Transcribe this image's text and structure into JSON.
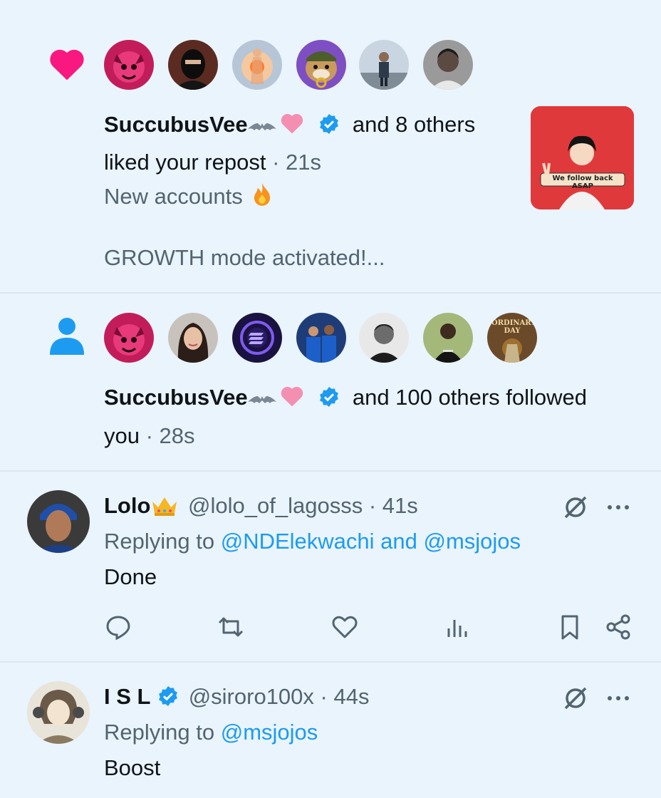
{
  "notifications": [
    {
      "type": "like",
      "actor": "SuccubusVee",
      "actor_emojis": [
        "bat-emoji",
        "pink-heart-emoji"
      ],
      "others_text": "and 8 others",
      "action_text": "liked your repost",
      "time": "· 21s",
      "preview_line1": "New accounts",
      "preview_line2": "GROWTH mode activated!...",
      "thumbnail_caption": "We follow back ASAP",
      "avatars": [
        "pink-demon-avatar",
        "masked-avatar",
        "glowing-figure-avatar",
        "bulldog-nft-avatar",
        "man-outdoors-avatar",
        "young-man-avatar"
      ]
    },
    {
      "type": "follow",
      "actor": "SuccubusVee",
      "others_text": "and 100 others followed",
      "action_text": "you",
      "time": "· 28s",
      "avatars": [
        "pink-demon-avatar",
        "woman-avatar",
        "solana-logo-avatar",
        "footballers-avatar",
        "bw-man-avatar",
        "man-in-field-avatar",
        "ordinary-day-avatar"
      ],
      "ordinary_day_text": "ORDINARY DAY"
    }
  ],
  "tweets": [
    {
      "name": "Lolo",
      "name_emoji": "crown-emoji",
      "handle": "@lolo_of_lagosss",
      "time": "· 41s",
      "replying_prefix": "Replying to",
      "replying_to": "@NDElekwachi and @msjojos",
      "text": "Done"
    },
    {
      "name": "I S L",
      "verified": true,
      "handle": "@siroro100x",
      "time": "· 44s",
      "replying_prefix": "Replying to",
      "replying_to": "@msjojos",
      "text": "Boost"
    }
  ],
  "colors": {
    "background": "#eaf4fc",
    "accent": "#1d9bf0",
    "like_pink": "#f91880",
    "muted_text": "#536471"
  }
}
